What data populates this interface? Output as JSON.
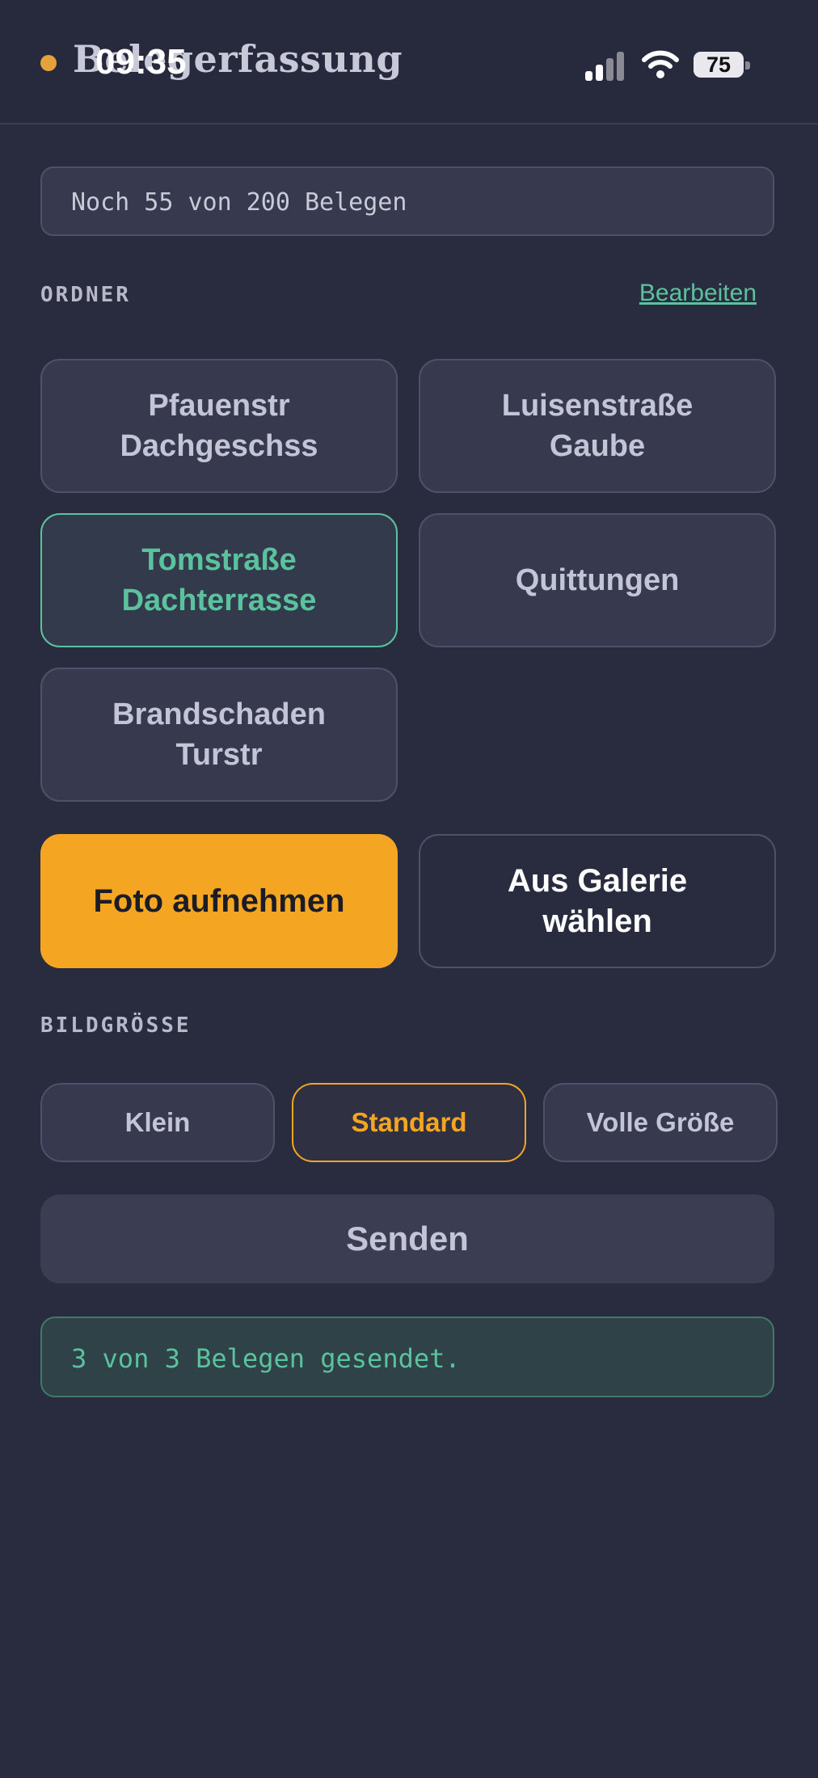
{
  "status_bar": {
    "time": "09:35",
    "battery": "75"
  },
  "header": {
    "title": "Belegerfassung"
  },
  "counter": {
    "text": "Noch 55 von 200 Belegen"
  },
  "folders_section": {
    "label": "ORDNER",
    "edit_label": "Bearbeiten",
    "items": [
      {
        "label": "Pfauenstr\nDachgeschss",
        "selected": false
      },
      {
        "label": "Luisenstraße\nGaube",
        "selected": false
      },
      {
        "label": "Tomstraße\nDachterrasse",
        "selected": true
      },
      {
        "label": "Quittungen",
        "selected": false
      },
      {
        "label": "Brandschaden\nTurstr",
        "selected": false
      }
    ]
  },
  "actions": {
    "photo_label": "Foto aufnehmen",
    "gallery_label": "Aus Galerie\nwählen"
  },
  "image_size_section": {
    "label": "BILDGRÖSSE",
    "options": [
      {
        "label": "Klein",
        "selected": false
      },
      {
        "label": "Standard",
        "selected": true
      },
      {
        "label": "Volle Größe",
        "selected": false
      }
    ]
  },
  "send": {
    "label": "Senden"
  },
  "status_message": {
    "text": "3 von 3 Belegen gesendet."
  },
  "colors": {
    "background": "#292c3f",
    "accent_green": "#5ac39d",
    "accent_orange": "#f4a623"
  }
}
